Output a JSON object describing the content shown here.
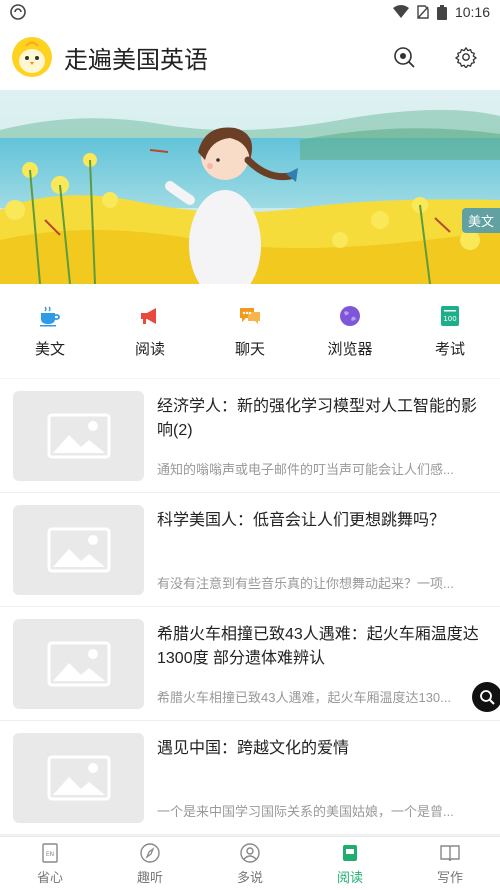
{
  "status_bar": {
    "time": "10:16"
  },
  "app_bar": {
    "title": "走遍美国英语"
  },
  "banner": {
    "tag": "美文"
  },
  "categories": [
    {
      "label": "美文",
      "icon": "coffee-cup-icon",
      "color": "#2e9be6"
    },
    {
      "label": "阅读",
      "icon": "megaphone-icon",
      "color": "#e8483d"
    },
    {
      "label": "聊天",
      "icon": "chat-bubble-icon",
      "color": "#f39a1e"
    },
    {
      "label": "浏览器",
      "icon": "globe-icon",
      "color": "#7d57d8"
    },
    {
      "label": "考试",
      "icon": "exam-paper-icon",
      "color": "#1fae8a"
    }
  ],
  "articles": [
    {
      "title": "经济学人：新的强化学习模型对人工智能的影响(2)",
      "summary": "通知的嗡嗡声或电子邮件的叮当声可能会让人们感..."
    },
    {
      "title": "科学美国人：低音会让人们更想跳舞吗？",
      "summary": "有没有注意到有些音乐真的让你想舞动起来？一项..."
    },
    {
      "title": "希腊火车相撞已致43人遇难：起火车厢温度达1300度 部分遗体难辨认",
      "summary": "希腊火车相撞已致43人遇难，起火车厢温度达130..."
    },
    {
      "title": "遇见中国：跨越文化的爱情",
      "summary": "一个是来中国学习国际关系的美国姑娘，一个是曾..."
    }
  ],
  "bottom_nav": [
    {
      "label": "省心",
      "icon": "book-en-icon",
      "active": false
    },
    {
      "label": "趣听",
      "icon": "compass-icon",
      "active": false
    },
    {
      "label": "多说",
      "icon": "person-icon",
      "active": false
    },
    {
      "label": "阅读",
      "icon": "reading-icon",
      "active": true
    },
    {
      "label": "写作",
      "icon": "open-book-icon",
      "active": false
    }
  ],
  "colors": {
    "accent": "#1fae6f",
    "avatar_bg": "#ffd21f"
  }
}
